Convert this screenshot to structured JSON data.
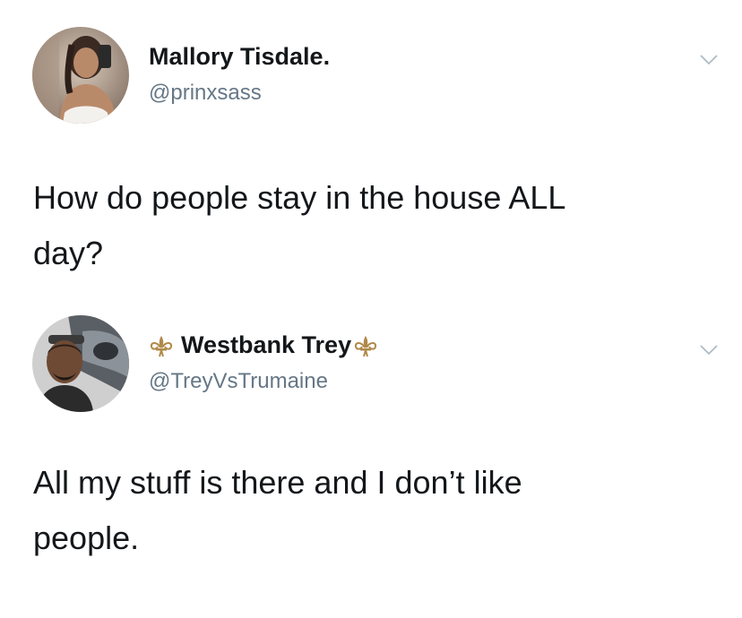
{
  "tweets": [
    {
      "display_name": "Mallory Tisdale.",
      "handle": "@prinxsass",
      "text": "How do people stay in the house ALL\nday?",
      "avatar_icon": "user-photo-avatar",
      "menu_icon": "chevron-down-icon"
    },
    {
      "display_name": "Westbank Trey",
      "handle": "@TreyVsTrumaine",
      "text": "All my stuff is there and I don’t like\npeople.",
      "name_icons": [
        "fleur-de-lis-icon",
        "fleur-de-lis-icon"
      ],
      "avatar_icon": "user-photo-avatar",
      "menu_icon": "chevron-down-icon"
    }
  ],
  "colors": {
    "text": "#14171a",
    "secondary_text": "#657786",
    "chevron": "#aab8c2",
    "fleur_gold": "#b0894a",
    "background": "#ffffff"
  }
}
